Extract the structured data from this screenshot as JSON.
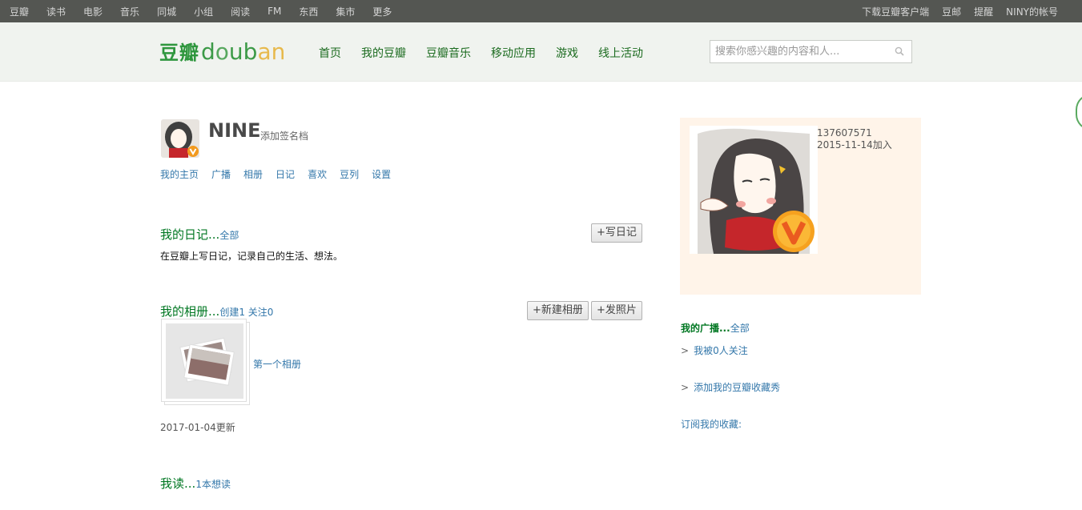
{
  "topnav": {
    "left": [
      "豆瓣",
      "读书",
      "电影",
      "音乐",
      "同城",
      "小组",
      "阅读",
      "FM",
      "东西",
      "集市",
      "更多"
    ],
    "right": [
      "下载豆瓣客户端",
      "豆邮",
      "提醒",
      "NINY的帐号"
    ]
  },
  "header": {
    "logo_cn": "豆瓣",
    "logo_en_d": "d",
    "logo_en_o": "o",
    "logo_en_ub": "ub",
    "logo_en_an": "an",
    "nav": [
      "首页",
      "我的豆瓣",
      "豆瓣音乐",
      "移动应用",
      "游戏",
      "线上活动"
    ],
    "search_placeholder": "搜索你感兴趣的内容和人..."
  },
  "profile": {
    "name": "NINE",
    "sign_link": "添加签名档",
    "tabs": [
      "我的主页",
      "广播",
      "相册",
      "日记",
      "喜欢",
      "豆列",
      "设置"
    ]
  },
  "diary": {
    "title": "我的日记...",
    "all_link": "全部",
    "button": "+写日记",
    "desc": "在豆瓣上写日记，记录自己的生活、想法。"
  },
  "album": {
    "title": "我的相册...",
    "meta": "创建1 关注0",
    "new_button": "+新建相册",
    "photo_button": "+发照片",
    "album_name": "第一个相册",
    "updated": "2017-01-04更新"
  },
  "reading": {
    "title": "我读...",
    "meta": "1本想读"
  },
  "sidebar": {
    "user_id": "137607571",
    "joined": "2015-11-14加入",
    "broadcast_title": "我的广播...",
    "broadcast_all": "全部",
    "followers": "我被0人关注",
    "add_collection_show": "添加我的豆瓣收藏秀",
    "subscribe": "订阅我的收藏:"
  }
}
